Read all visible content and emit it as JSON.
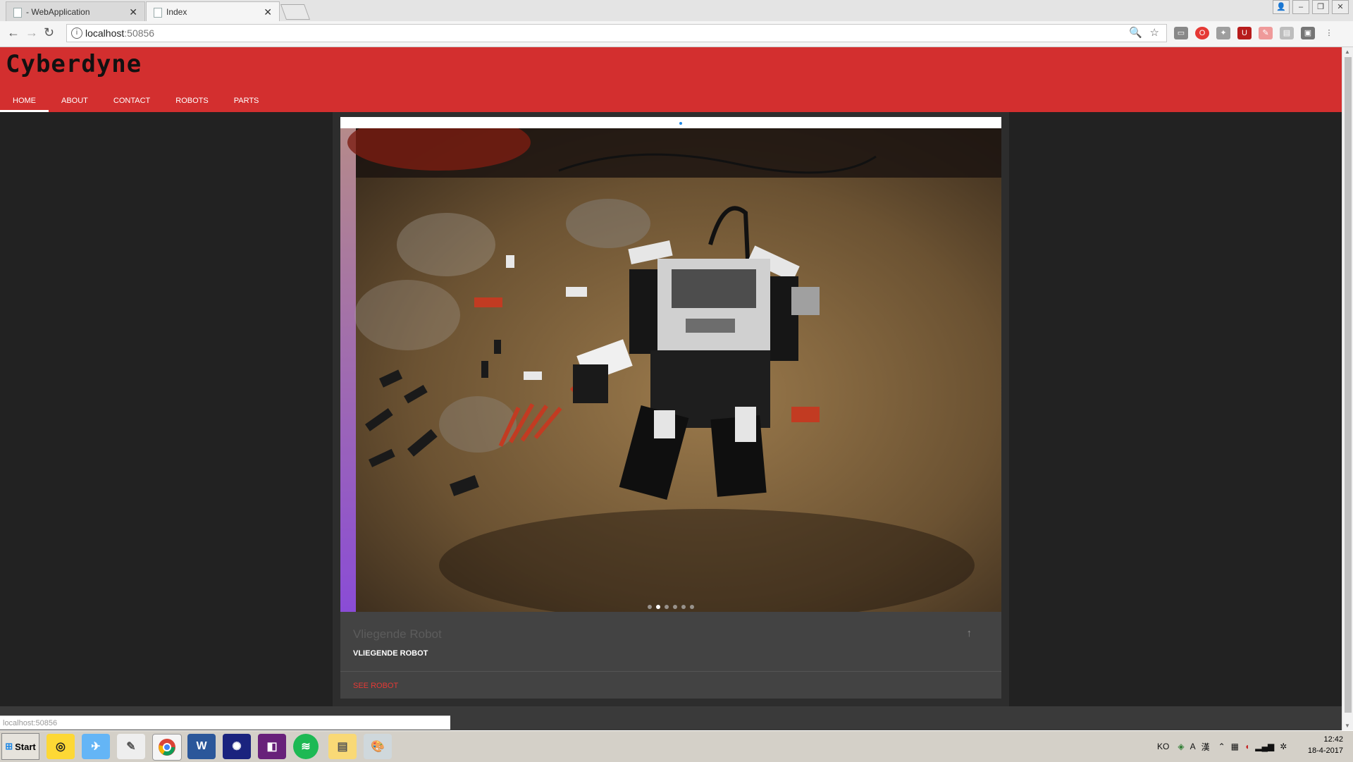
{
  "browser": {
    "tabs": [
      {
        "title": "- WebApplication"
      },
      {
        "title": "Index"
      }
    ],
    "address": {
      "host": "localhost",
      "port": ":50856"
    },
    "status_text": "localhost:50856"
  },
  "site": {
    "logo": "Cyberdyne",
    "nav": [
      {
        "label": "HOME"
      },
      {
        "label": "ABOUT"
      },
      {
        "label": "CONTACT"
      },
      {
        "label": "ROBOTS"
      },
      {
        "label": "PARTS"
      }
    ],
    "active_nav": "HOME",
    "colors": {
      "header": "#d32f2f",
      "action": "#e53935",
      "card": "#434343"
    }
  },
  "card": {
    "title": "Vliegende Robot",
    "subtitle": "VLIEGENDE ROBOT",
    "action": "SEE ROBOT",
    "slide_count": 6,
    "active_slide": 2
  },
  "taskbar": {
    "start_label": "Start",
    "apps": [
      "app-icon",
      "chrome-icon",
      "word-icon",
      "visual-studio-icon",
      "spotify-icon",
      "explorer-icon",
      "paint-icon"
    ],
    "lang": "KO",
    "time": "12:42",
    "date": "18-4-2017"
  }
}
